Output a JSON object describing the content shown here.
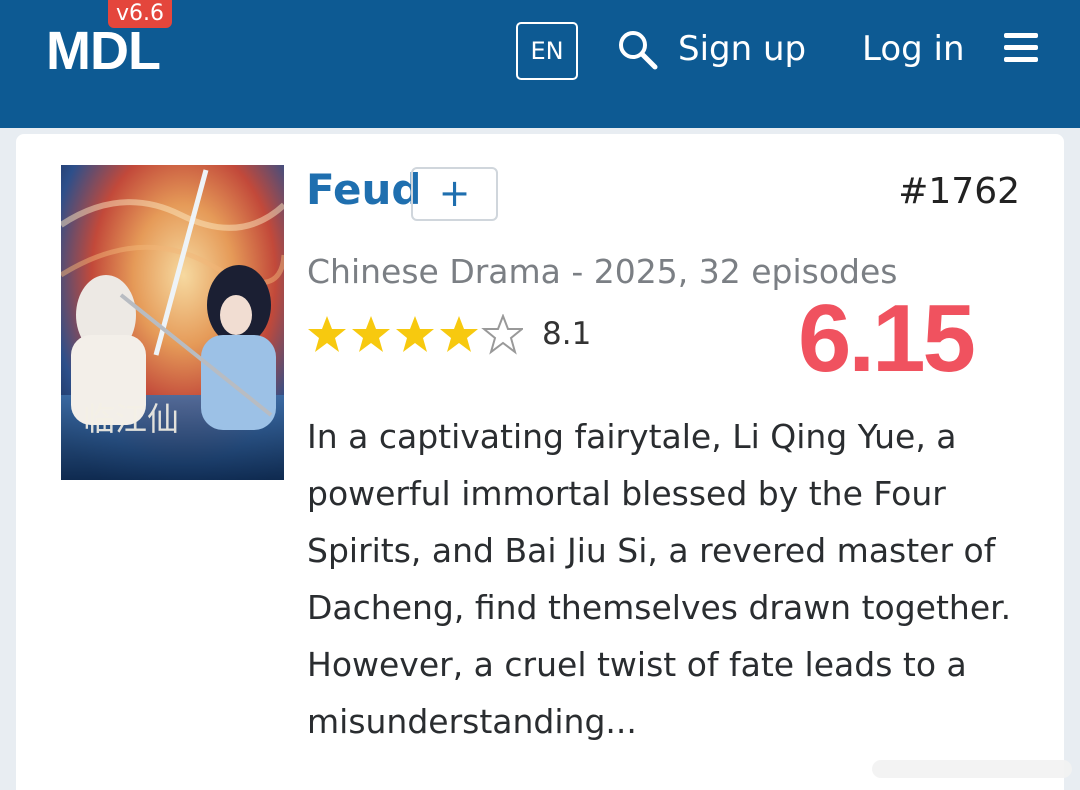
{
  "header": {
    "logo": "MDL",
    "version": "v6.6",
    "lang": "EN",
    "signup_label": "Sign up",
    "login_label": "Log in"
  },
  "drama": {
    "title": "Feud",
    "add_label": "+",
    "rank": "#1762",
    "meta": "Chinese Drama - 2025, 32 episodes",
    "stars": 4,
    "rating": "8.1",
    "big_score": "6.15",
    "synopsis": "In a captivating fairytale, Li Qing Yue, a powerful immortal blessed by the Four Spirits, and Bai Jiu Si, a revered master of Dacheng, find themselves drawn together. However, a cruel twist of fate leads to a misunderstanding..."
  },
  "colors": {
    "header_bg": "#0d5a93",
    "title": "#1f6faf",
    "star": "#f7c90f",
    "score": "#f0525f",
    "version_badge": "#e4463c"
  },
  "icons": [
    "search-icon",
    "menu-icon",
    "star-icon",
    "star-outline-icon"
  ]
}
